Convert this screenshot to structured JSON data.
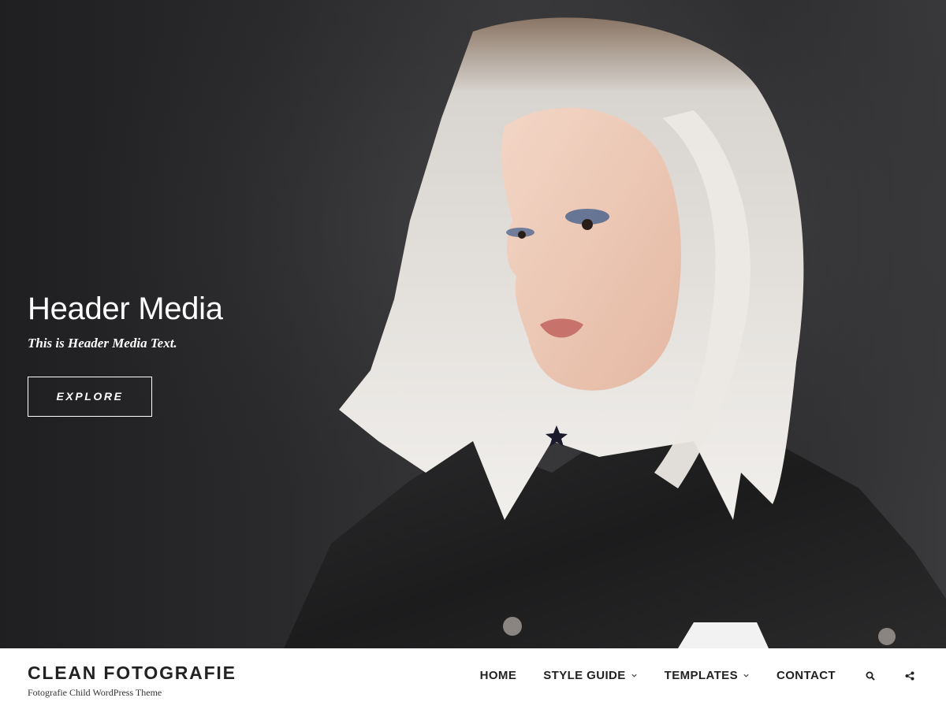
{
  "hero": {
    "title": "Header Media",
    "text": "This is Header Media Text.",
    "button_label": "EXPLORE"
  },
  "header": {
    "site_title": "CLEAN FOTOGRAFIE",
    "tagline": "Fotografie Child WordPress Theme"
  },
  "nav": {
    "items": [
      {
        "label": "HOME"
      },
      {
        "label": "STYLE GUIDE",
        "dropdown": true
      },
      {
        "label": "TEMPLATES",
        "dropdown": true
      },
      {
        "label": "CONTACT"
      }
    ],
    "icons": [
      "search-icon",
      "share-icon"
    ]
  }
}
